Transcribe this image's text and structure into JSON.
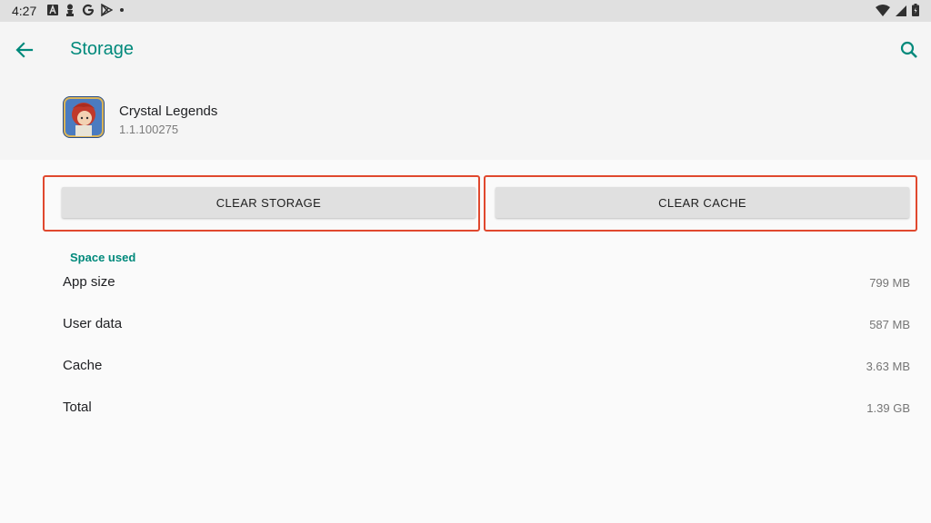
{
  "status_bar": {
    "time": "4:27"
  },
  "app_bar": {
    "title": "Storage"
  },
  "app": {
    "name": "Crystal Legends",
    "version": "1.1.100275"
  },
  "buttons": {
    "clear_storage": "CLEAR STORAGE",
    "clear_cache": "CLEAR CACHE"
  },
  "space_used": {
    "header": "Space used",
    "rows": [
      {
        "label": "App size",
        "value": "799 MB"
      },
      {
        "label": "User data",
        "value": "587 MB"
      },
      {
        "label": "Cache",
        "value": "3.63 MB"
      },
      {
        "label": "Total",
        "value": "1.39 GB"
      }
    ]
  },
  "colors": {
    "accent": "#00897b",
    "highlight_border": "#e0482e",
    "button_bg": "#e0e0e0"
  }
}
